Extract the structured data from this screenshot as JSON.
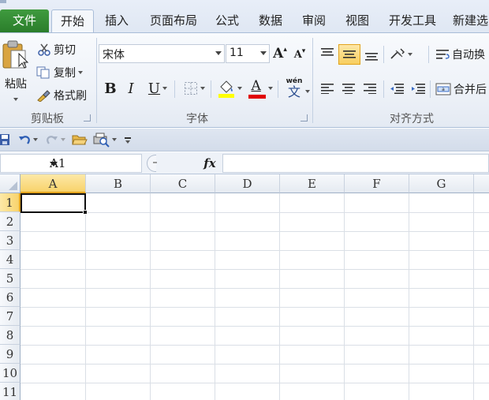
{
  "tabs": {
    "file": "文件",
    "home": "开始",
    "insert": "插入",
    "page_layout": "页面布局",
    "formulas": "公式",
    "data": "数据",
    "review": "审阅",
    "view": "视图",
    "developer": "开发工具",
    "new_tab": "新建选"
  },
  "clipboard": {
    "paste_label": "粘贴",
    "cut_label": "剪切",
    "copy_label": "复制",
    "format_painter_label": "格式刷",
    "group_label": "剪贴板"
  },
  "font": {
    "font_name": "宋体",
    "font_size": "11",
    "bold": "B",
    "italic": "I",
    "underline": "U",
    "font_color_letter": "A",
    "phonetic_top": "wén",
    "phonetic_bottom": "文",
    "grow_letter": "A",
    "shrink_letter": "A",
    "group_label": "字体"
  },
  "alignment": {
    "wrap_text_label": "自动换",
    "merge_label": "合并后",
    "group_label": "对齐方式"
  },
  "formula_bar": {
    "name_box": "A1",
    "fx_label": "fx",
    "formula_value": ""
  },
  "sheet": {
    "columns": [
      "A",
      "B",
      "C",
      "D",
      "E",
      "F",
      "G"
    ],
    "rows": [
      "1",
      "2",
      "3",
      "4",
      "5",
      "6",
      "7",
      "8",
      "9",
      "10",
      "11"
    ],
    "active_cell": "A1"
  },
  "colors": {
    "file_tab": "#2e862e",
    "selected_header": "#f8d36b",
    "highlight_yellow": "#ffff00",
    "font_red": "#e00000",
    "ribbon_border": "#a9bdd8"
  }
}
